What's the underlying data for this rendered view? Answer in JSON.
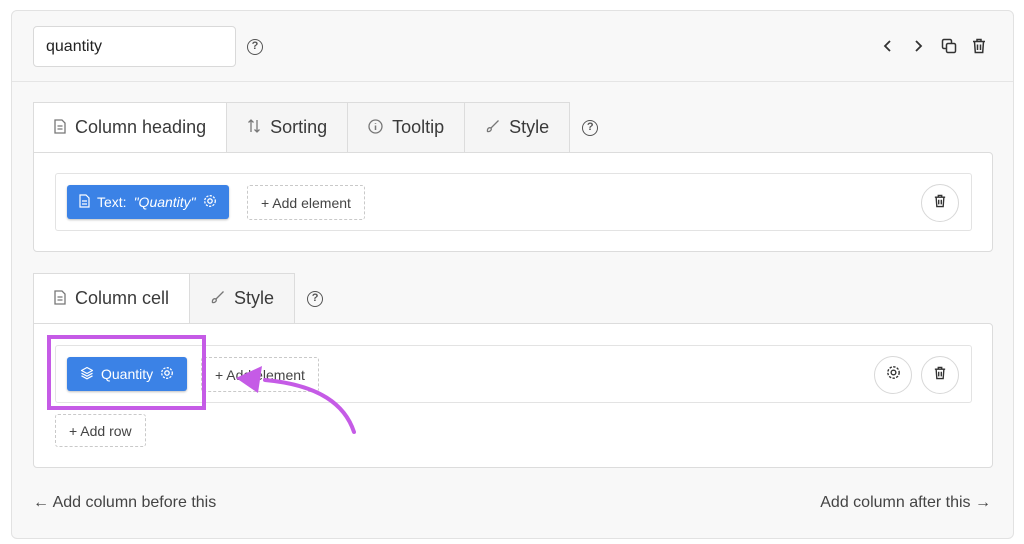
{
  "header": {
    "name_value": "quantity",
    "help_icon": "help-circle-icon",
    "actions": [
      "chevron-left-icon",
      "chevron-right-icon",
      "copy-icon",
      "trash-icon"
    ]
  },
  "heading_section": {
    "tabs": [
      {
        "label": "Column heading",
        "icon": "document-icon"
      },
      {
        "label": "Sorting",
        "icon": "sort-icon"
      },
      {
        "label": "Tooltip",
        "icon": "info-icon"
      },
      {
        "label": "Style",
        "icon": "brush-icon"
      }
    ],
    "element_prefix": "Text:",
    "element_value": "\"Quantity\"",
    "add_element": "+ Add element"
  },
  "cell_section": {
    "tabs": [
      {
        "label": "Column cell",
        "icon": "document-icon"
      },
      {
        "label": "Style",
        "icon": "brush-icon"
      }
    ],
    "element_label": "Quantity",
    "add_element": "+ Add element",
    "add_row": "+ Add row"
  },
  "footer": {
    "add_before": "← Add column before this",
    "add_after": "Add column after this →"
  },
  "colors": {
    "accent": "#3b82e6",
    "highlight": "#c55be6"
  }
}
